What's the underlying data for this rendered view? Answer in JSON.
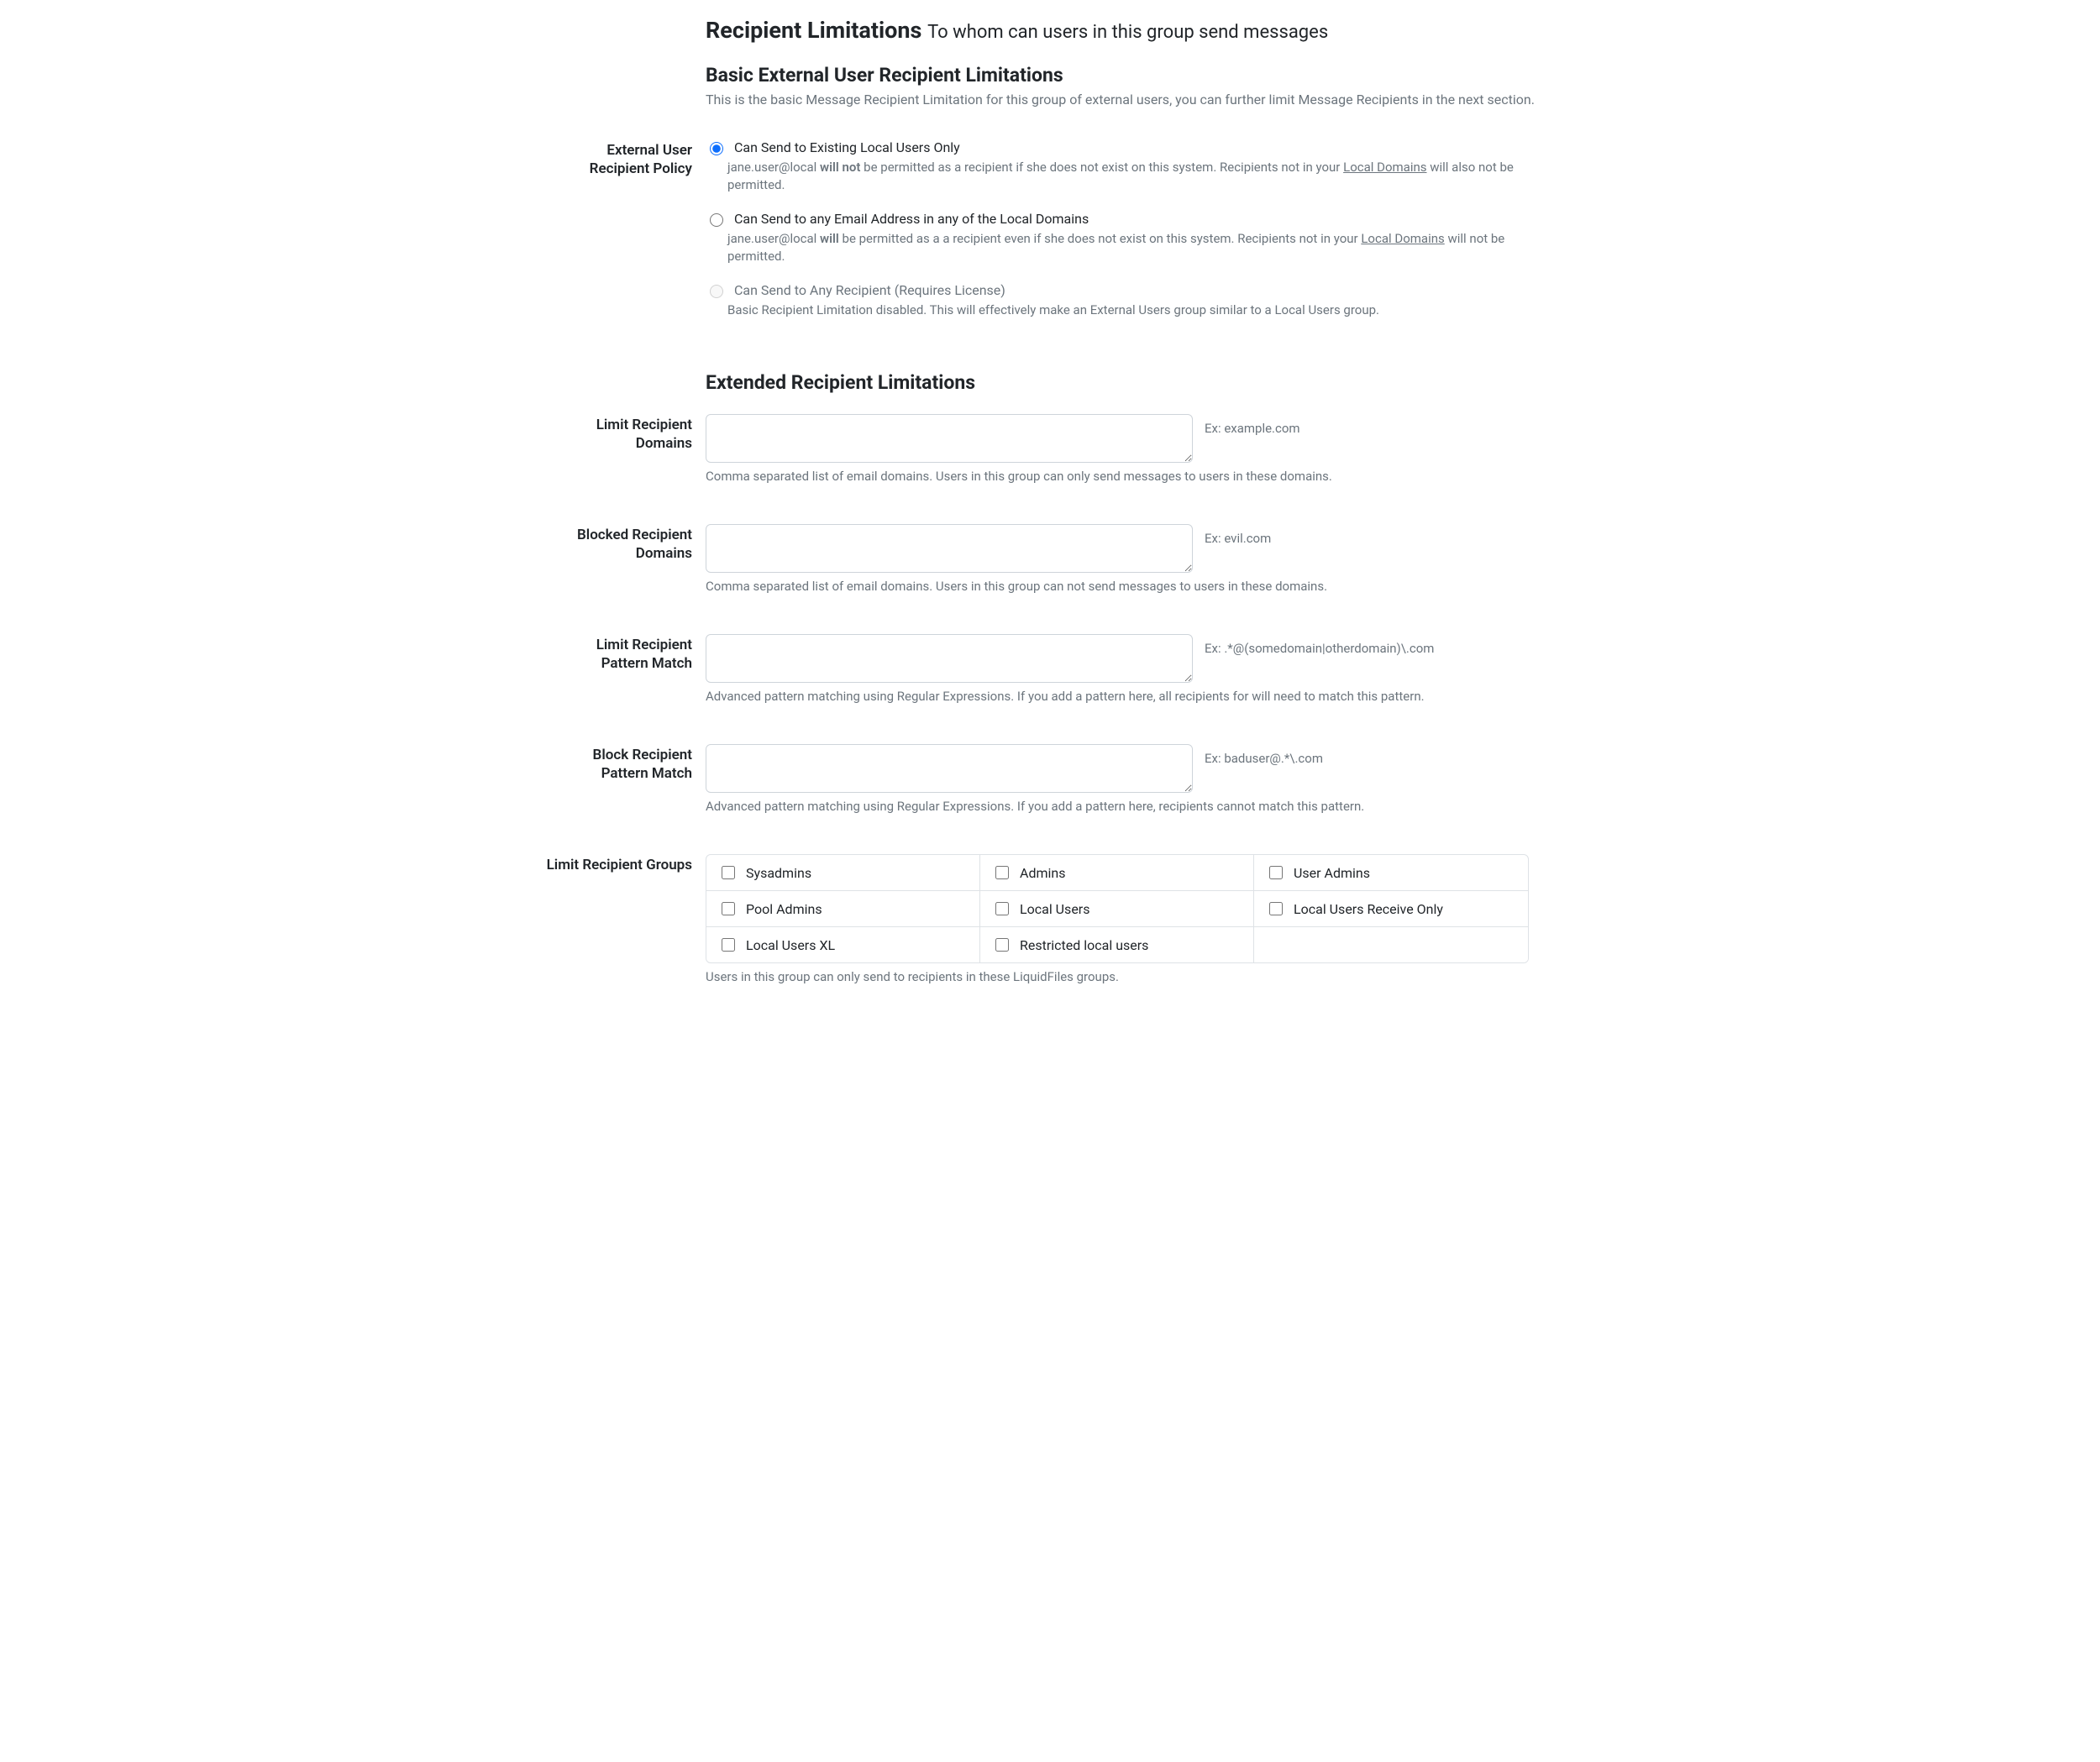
{
  "header": {
    "title": "Recipient Limitations",
    "subtitle": "To whom can users in this group send messages"
  },
  "basic": {
    "heading": "Basic External User Recipient Limitations",
    "lead": "This is the basic Message Recipient Limitation for this group of external users, you can further limit Message Recipients in the next section.",
    "label": "External User Recipient Policy",
    "options": [
      {
        "label": "Can Send to Existing Local Users Only",
        "help_pre": "jane.user@local ",
        "help_bold": "will not",
        "help_mid": " be permitted as a recipient if she does not exist on this system. Recipients not in your ",
        "help_link": "Local Domains",
        "help_post": " will also not be permitted.",
        "checked": true,
        "disabled": false
      },
      {
        "label": "Can Send to any Email Address in any of the Local Domains",
        "help_pre": "jane.user@local ",
        "help_bold": "will",
        "help_mid": " be permitted as a a recipient even if she does not exist on this system. Recipients not in your ",
        "help_link": "Local Domains",
        "help_post": " will not be permitted.",
        "checked": false,
        "disabled": false
      },
      {
        "label": "Can Send to Any Recipient (Requires License)",
        "help_plain": "Basic Recipient Limitation disabled. This will effectively make an External Users group similar to a Local Users group.",
        "checked": false,
        "disabled": true
      }
    ]
  },
  "extended": {
    "heading": "Extended Recipient Limitations",
    "fields": [
      {
        "label": "Limit Recipient Domains",
        "example": "Ex: example.com",
        "help": "Comma separated list of email domains. Users in this group can only send messages to users in these domains.",
        "value": ""
      },
      {
        "label": "Blocked Recipient Domains",
        "example": "Ex: evil.com",
        "help": "Comma separated list of email domains. Users in this group can not send messages to users in these domains.",
        "value": ""
      },
      {
        "label": "Limit Recipient Pattern Match",
        "example": "Ex: .*@(somedomain|otherdomain)\\.com",
        "help": "Advanced pattern matching using Regular Expressions. If you add a pattern here, all recipients for will need to match this pattern.",
        "value": ""
      },
      {
        "label": "Block Recipient Pattern Match",
        "example": "Ex: baduser@.*\\.com",
        "help": "Advanced pattern matching using Regular Expressions. If you add a pattern here, recipients cannot match this pattern.",
        "value": ""
      }
    ],
    "groups": {
      "label": "Limit Recipient Groups",
      "help": "Users in this group can only send to recipients in these LiquidFiles groups.",
      "items": [
        "Sysadmins",
        "Admins",
        "User Admins",
        "Pool Admins",
        "Local Users",
        "Local Users Receive Only",
        "Local Users XL",
        "Restricted local users"
      ]
    }
  }
}
